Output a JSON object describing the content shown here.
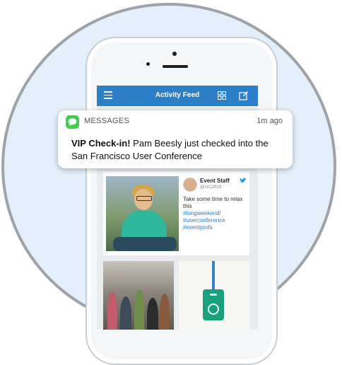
{
  "app": {
    "header_title": "Activity Feed",
    "menu_icon": "hamburger-menu-icon",
    "grid_icon": "grid-view-icon",
    "compose_icon": "compose-icon",
    "accent_color": "#2a7fc8"
  },
  "notification": {
    "app_name": "MESSAGES",
    "time": "1m ago",
    "title": "VIP Check-in!",
    "message": " Pam Beesly just checked into the San Francisco User Conference",
    "icon": "messages-app-icon",
    "icon_color": "#3ecf4c"
  },
  "feed": {
    "tweet": {
      "name": "Event Staff",
      "handle": "@UC2018",
      "text": "Take some time to relax this",
      "hashtags": [
        "#longweekend!",
        "#userconference",
        "#eventprofs"
      ],
      "icon": "twitter-bird-icon"
    }
  }
}
